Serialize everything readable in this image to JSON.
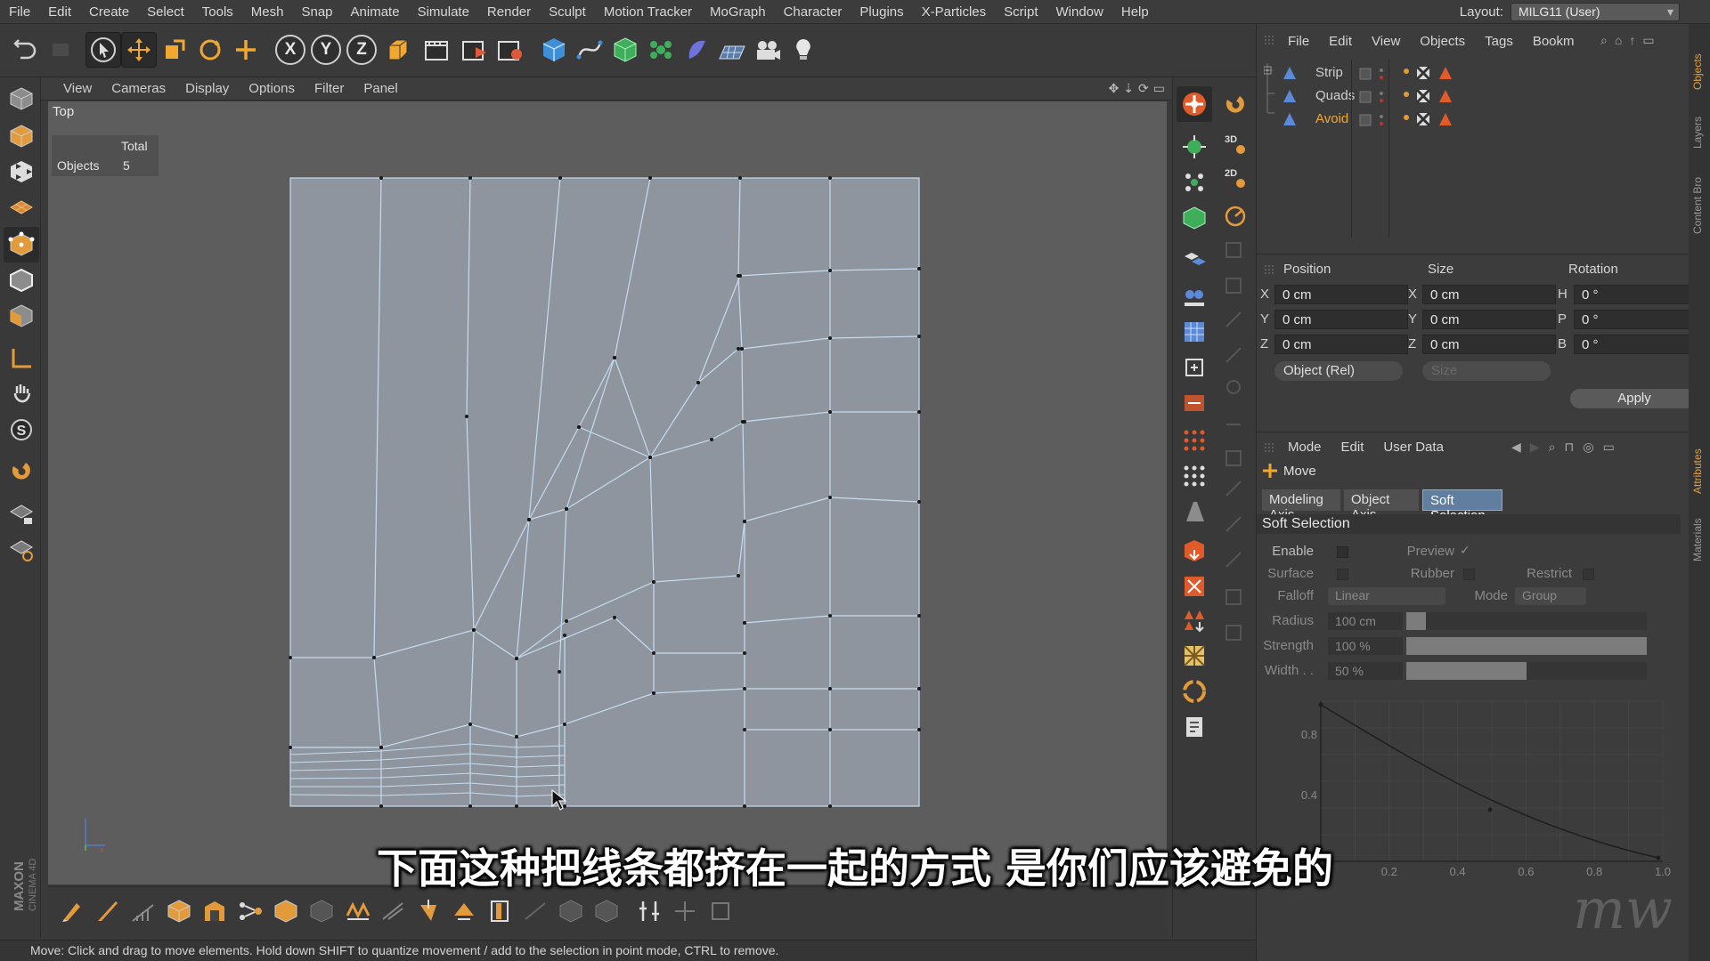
{
  "menubar": {
    "items": [
      "File",
      "Edit",
      "Create",
      "Select",
      "Tools",
      "Mesh",
      "Snap",
      "Animate",
      "Simulate",
      "Render",
      "Sculpt",
      "Motion Tracker",
      "MoGraph",
      "Character",
      "Plugins",
      "X-Particles",
      "Script",
      "Window",
      "Help"
    ],
    "layout_label": "Layout:",
    "layout_value": "MILG11 (User)"
  },
  "toolbar": {
    "axis_x": "X",
    "axis_y": "Y",
    "axis_z": "Z"
  },
  "viewport": {
    "menu": [
      "View",
      "Cameras",
      "Display",
      "Options",
      "Filter",
      "Panel"
    ],
    "view_name": "Top",
    "hud_total": "Total",
    "hud_objects_label": "Objects",
    "hud_objects_value": "5"
  },
  "status_bar": "Move: Click and drag to move elements. Hold down SHIFT to quantize movement / add to the selection in point mode, CTRL to remove.",
  "brand": {
    "maxon": "MAXON",
    "product": "CINEMA 4D"
  },
  "object_manager": {
    "menu": [
      "File",
      "Edit",
      "View",
      "Objects",
      "Tags",
      "Bookm"
    ],
    "objects": [
      {
        "name": "Strip",
        "selected": false
      },
      {
        "name": "Quads",
        "selected": false
      },
      {
        "name": "Avoid",
        "selected": true
      }
    ]
  },
  "coordinates": {
    "headers": {
      "position": "Position",
      "size": "Size",
      "rotation": "Rotation"
    },
    "rows": [
      {
        "pos_axis": "X",
        "pos": "0 cm",
        "size_axis": "X",
        "size": "0 cm",
        "rot_axis": "H",
        "rot": "0 °"
      },
      {
        "pos_axis": "Y",
        "pos": "0 cm",
        "size_axis": "Y",
        "size": "0 cm",
        "rot_axis": "P",
        "rot": "0 °"
      },
      {
        "pos_axis": "Z",
        "pos": "0 cm",
        "size_axis": "Z",
        "size": "0 cm",
        "rot_axis": "B",
        "rot": "0 °"
      }
    ],
    "mode_select": "Object (Rel)",
    "size_select": "Size",
    "apply": "Apply"
  },
  "attributes": {
    "menu": [
      "Mode",
      "Edit",
      "User Data"
    ],
    "tool_name": "Move",
    "tabs": [
      "Modeling Axis",
      "Object Axis",
      "Soft Selection"
    ],
    "active_tab": 2,
    "section": "Soft Selection",
    "enable": "Enable",
    "preview": "Preview",
    "surface": "Surface",
    "rubber": "Rubber",
    "restrict": "Restrict",
    "falloff_label": "Falloff",
    "falloff_value": "Linear",
    "mode_label": "Mode",
    "mode_value": "Group",
    "radius_label": "Radius",
    "radius_value": "100 cm",
    "radius_level": 0.08,
    "strength_label": "Strength",
    "strength_value": "100 %",
    "strength_level": 1.0,
    "width_label": "Width . .",
    "width_value": "50 %",
    "width_level": 0.5,
    "graph_y_ticks": [
      "0.8",
      "0.4"
    ],
    "graph_x_ticks": [
      "0.2",
      "0.4",
      "0.6",
      "0.8",
      "1.0"
    ]
  },
  "side_tabs": [
    "Objects",
    "Layers",
    "Content Bro",
    "Attributes",
    "Materials"
  ],
  "subtitle": "下面这种把线条都挤在一起的方式 是你们应该避免的",
  "colors": {
    "accent": "#f0a830",
    "selection_tab": "#5f7ea0",
    "mesh_face": "#8e959e",
    "mesh_edge": "#c6dcef"
  }
}
